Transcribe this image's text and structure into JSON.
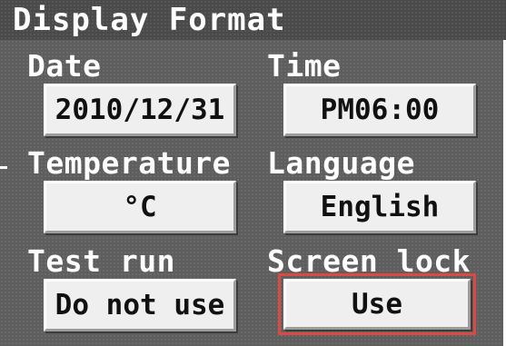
{
  "window": {
    "title": "Display Format"
  },
  "settings": {
    "date": {
      "label": "Date",
      "value": "2010/12/31"
    },
    "time": {
      "label": "Time",
      "value": "PM06:00"
    },
    "temperature": {
      "label": "Temperature",
      "value": "°C"
    },
    "language": {
      "label": "Language",
      "value": "English"
    },
    "test_run": {
      "label": "Test run",
      "value": "Do not use"
    },
    "screen_lock": {
      "label": "Screen lock",
      "value": "Use",
      "selected": true
    }
  },
  "colors": {
    "background": "#5e5e5e",
    "titlebar": "#4a4a4a",
    "button_face": "#efefef",
    "selection": "#d84a42"
  }
}
